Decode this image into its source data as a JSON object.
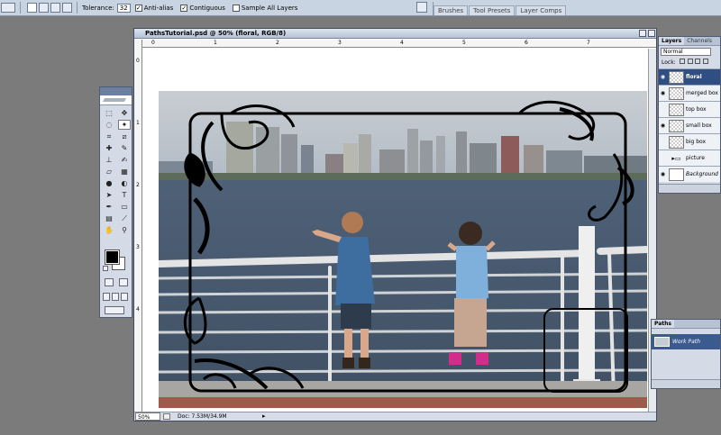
{
  "options_bar": {
    "tolerance_label": "Tolerance:",
    "tolerance_value": "32",
    "anti_alias_label": "Anti-alias",
    "contiguous_label": "Contiguous",
    "sample_all_layers_label": "Sample All Layers",
    "anti_alias_checked": true,
    "contiguous_checked": true,
    "sample_all_layers_checked": false
  },
  "palette_well": {
    "tabs": [
      "Brushes",
      "Tool Presets",
      "Layer Comps"
    ]
  },
  "document": {
    "title": "PathsTutorial.psd @ 50% (floral, RGB/8)",
    "zoom": "50%",
    "doc_info": "Doc: 7.53M/34.9M",
    "ruler_top": [
      "0",
      "1",
      "2",
      "3",
      "4",
      "5",
      "6",
      "7"
    ],
    "ruler_left": [
      "0",
      "1",
      "2",
      "3",
      "4"
    ]
  },
  "layers_panel": {
    "tabs": [
      "Layers",
      "Channels"
    ],
    "blend_mode": "Normal",
    "lock_label": "Lock:",
    "layers": [
      {
        "name": "floral",
        "visible": true,
        "active": true,
        "kind": "transparent"
      },
      {
        "name": "merged box",
        "visible": true,
        "active": false,
        "kind": "transparent"
      },
      {
        "name": "top box",
        "visible": false,
        "active": false,
        "kind": "transparent"
      },
      {
        "name": "small box",
        "visible": true,
        "active": false,
        "kind": "transparent"
      },
      {
        "name": "big box",
        "visible": false,
        "active": false,
        "kind": "transparent"
      },
      {
        "name": "picture",
        "visible": false,
        "active": false,
        "kind": "folder"
      },
      {
        "name": "Background",
        "visible": true,
        "active": false,
        "kind": "white"
      }
    ]
  },
  "paths_panel": {
    "tab": "Paths",
    "items": [
      "Work Path"
    ]
  },
  "colors": {
    "foreground": "#000000",
    "background": "#ffffff",
    "accent": "#2f4e82"
  }
}
